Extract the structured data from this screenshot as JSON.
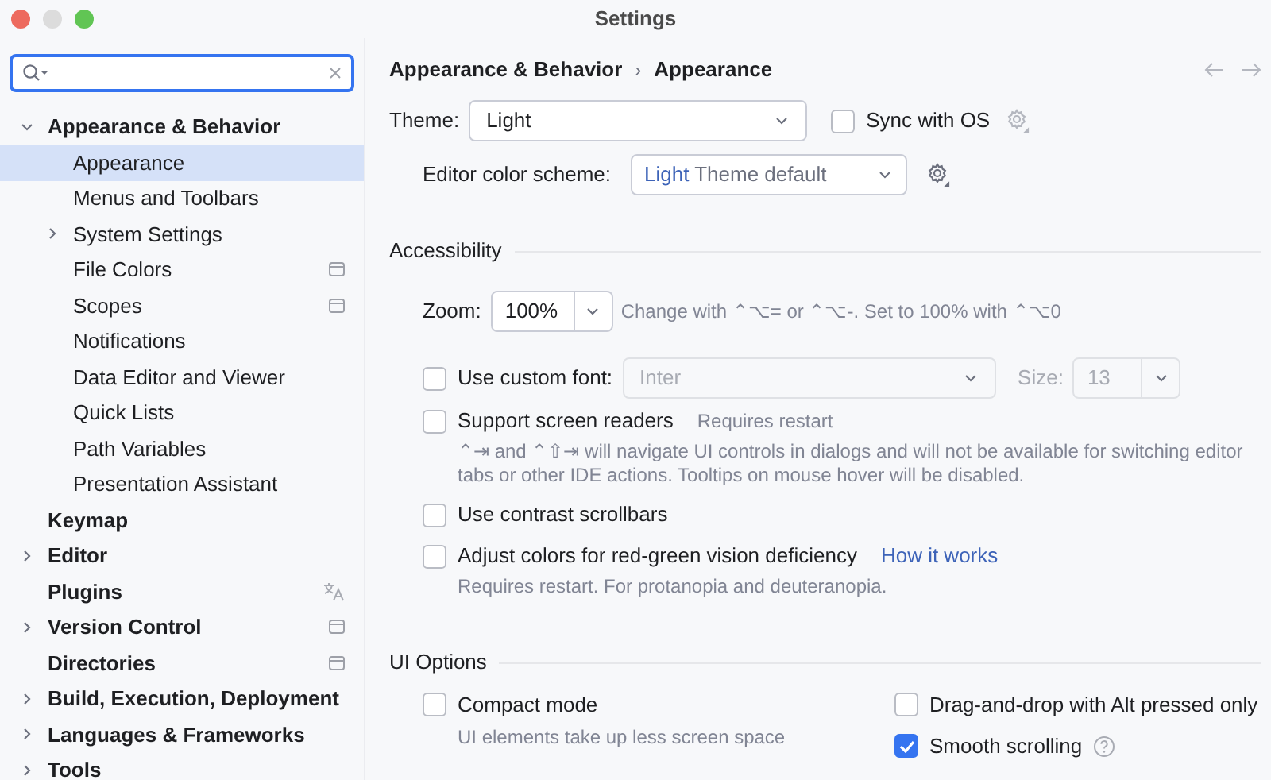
{
  "window": {
    "title": "Settings"
  },
  "tree": [
    {
      "label": "Appearance & Behavior",
      "expanded": true,
      "selected": false,
      "children": [
        {
          "label": "Appearance",
          "selected": true
        },
        {
          "label": "Menus and Toolbars",
          "selected": false
        },
        {
          "label": "System Settings",
          "expanded": false,
          "selected": false
        },
        {
          "label": "File Colors",
          "selected": false,
          "project_icon": true
        },
        {
          "label": "Scopes",
          "selected": false,
          "project_icon": true
        },
        {
          "label": "Notifications",
          "selected": false
        },
        {
          "label": "Data Editor and Viewer",
          "selected": false
        },
        {
          "label": "Quick Lists",
          "selected": false
        },
        {
          "label": "Path Variables",
          "selected": false
        },
        {
          "label": "Presentation Assistant",
          "selected": false
        }
      ]
    },
    {
      "label": "Keymap",
      "selected": false
    },
    {
      "label": "Editor",
      "expanded": false,
      "selected": false
    },
    {
      "label": "Plugins",
      "selected": false,
      "language_icon": true
    },
    {
      "label": "Version Control",
      "expanded": false,
      "selected": false,
      "project_icon": true
    },
    {
      "label": "Directories",
      "selected": false,
      "project_icon": true
    },
    {
      "label": "Build, Execution, Deployment",
      "expanded": false,
      "selected": false
    },
    {
      "label": "Languages & Frameworks",
      "expanded": false,
      "selected": false
    },
    {
      "label": "Tools",
      "expanded": false,
      "selected": false
    }
  ],
  "breadcrumb": [
    "Appearance & Behavior",
    "Appearance"
  ],
  "breadcrumb_separator": "›",
  "theme": {
    "label": "Theme:",
    "value": "Light",
    "sync_label": "Sync with OS",
    "sync_checked": false
  },
  "color_scheme": {
    "label": "Editor color scheme:",
    "value_name": "Light",
    "value_note": "Theme default"
  },
  "accessibility": {
    "title": "Accessibility",
    "zoom": {
      "label": "Zoom:",
      "value": "100%",
      "hint": "Change with ⌃⌥= or ⌃⌥-. Set to 100% with ⌃⌥0"
    },
    "options": [
      {
        "kind": "font",
        "label": "Use custom font:",
        "checked": false,
        "font": "Inter",
        "size_label": "Size:",
        "size": "13"
      },
      {
        "kind": "check",
        "label": "Support screen readers",
        "checked": false,
        "note": "Requires restart",
        "description": "⌃⇥ and ⌃⇧⇥ will navigate UI controls in dialogs and will not be available for switching editor tabs or other IDE actions. Tooltips on mouse hover will be disabled."
      },
      {
        "kind": "check",
        "label": "Use contrast scrollbars",
        "checked": false
      },
      {
        "kind": "check",
        "label": "Adjust colors for red-green vision deficiency",
        "checked": false,
        "link": "How it works",
        "description": "Requires restart. For protanopia and deuteranopia."
      }
    ]
  },
  "ui_options": {
    "title": "UI Options",
    "left": [
      {
        "label": "Compact mode",
        "checked": false,
        "description": "UI elements take up less screen space"
      }
    ],
    "right": [
      {
        "label": "Drag-and-drop with Alt pressed only",
        "checked": false
      },
      {
        "label": "Smooth scrolling",
        "checked": true,
        "help": true
      }
    ]
  }
}
